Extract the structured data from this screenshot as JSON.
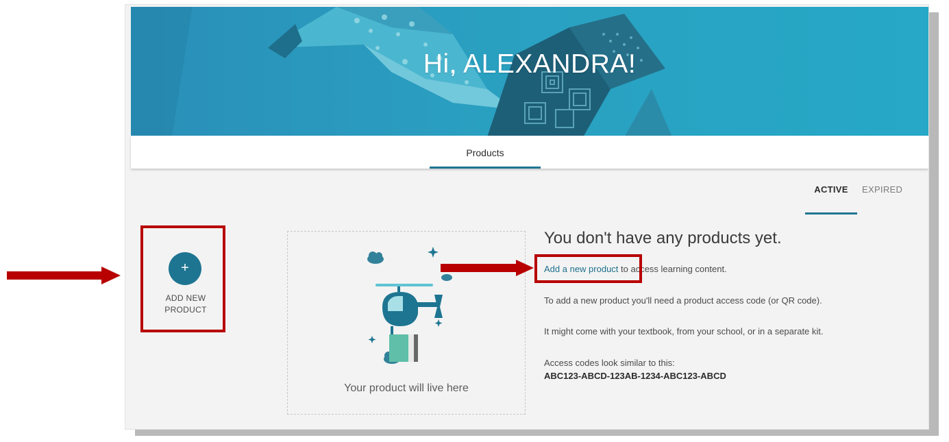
{
  "hero": {
    "greeting": "Hi, ALEXANDRA!"
  },
  "tabs": {
    "products_label": "Products"
  },
  "filters": {
    "active_label": "ACTIVE",
    "expired_label": "EXPIRED"
  },
  "add_product": {
    "icon": "plus-icon",
    "glyph": "+",
    "label_line1": "ADD NEW",
    "label_line2": "PRODUCT"
  },
  "placeholder": {
    "illustration": "helicopter-illustration",
    "text": "Your product will live here"
  },
  "empty_state": {
    "title": "You don't have any products yet.",
    "link_text": "Add a new product",
    "link_suffix": " to access learning content.",
    "line2": "To add a new product you'll need a product access code (or QR code).",
    "line3": "It might come with your textbook, from your school, or in a separate kit.",
    "line4": "Access codes look similar to this:",
    "code_example": "ABC123-ABCD-123AB-1234-ABC123-ABCD"
  },
  "annotations": {
    "highlight_color": "#b80000",
    "accent_color": "#1e7591"
  }
}
